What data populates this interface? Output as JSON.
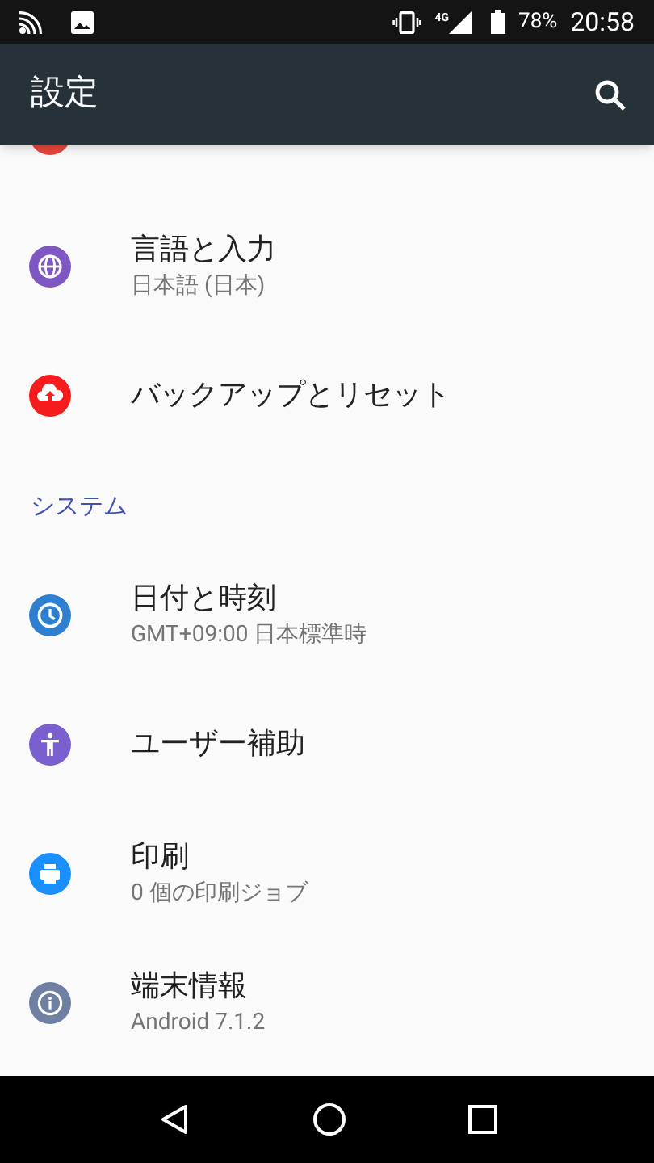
{
  "status_bar": {
    "network": "4G",
    "battery": "78%",
    "time": "20:58"
  },
  "app_bar": {
    "title": "設定"
  },
  "list": [
    {
      "kind": "item",
      "title": "言語と入力",
      "subtitle": "日本語 (日本)",
      "color": "#7e57c2"
    },
    {
      "kind": "item",
      "title": "バックアップとリセット",
      "color": "#f41c1c"
    },
    {
      "kind": "header",
      "title": "システム"
    },
    {
      "kind": "item",
      "title": "日付と時刻",
      "subtitle": "GMT+09:00 日本標準時",
      "color": "#2f7fd1"
    },
    {
      "kind": "item",
      "title": "ユーザー補助",
      "color": "#7a5fcf"
    },
    {
      "kind": "item",
      "title": "印刷",
      "subtitle": "0 個の印刷ジョブ",
      "color": "#1a90ff"
    },
    {
      "kind": "item",
      "title": "端末情報",
      "subtitle": "Android 7.1.2",
      "color": "#6f80a3"
    }
  ]
}
